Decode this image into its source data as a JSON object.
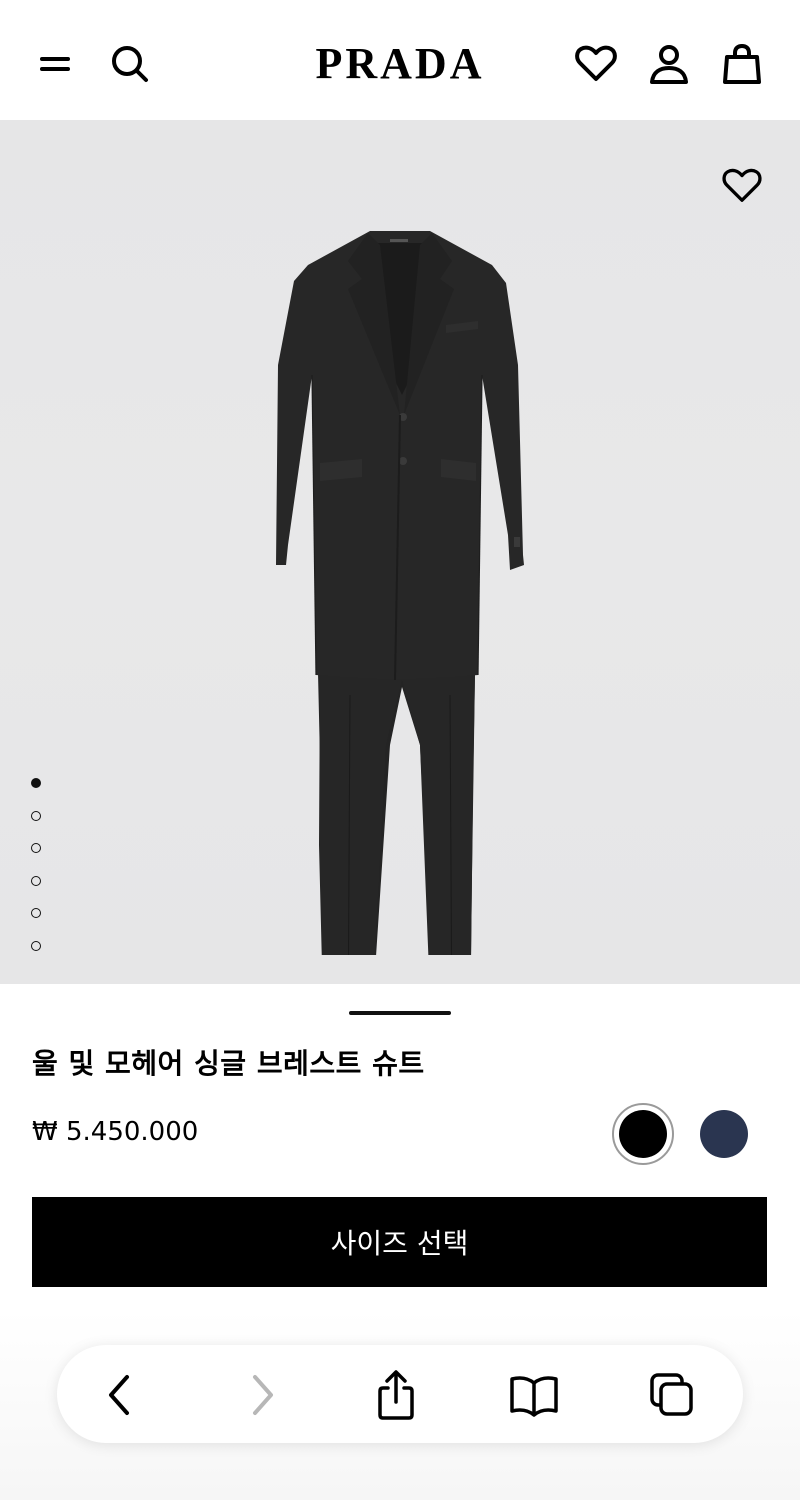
{
  "header": {
    "brand": "PRADA",
    "icons": [
      "menu-icon",
      "search-icon",
      "heart-icon",
      "user-icon",
      "shopping-bag-icon"
    ]
  },
  "gallery": {
    "image_description_icon": "suit-image",
    "image_count": 6,
    "active_index": 1,
    "favorite_icon": "heart-icon"
  },
  "product": {
    "title": "울 및 모헤어 싱글 브레스트 슈트",
    "price": "₩ 5.450.000",
    "colors": [
      {
        "name": "black",
        "hex": "#000000",
        "selected": true
      },
      {
        "name": "navy",
        "hex": "#2a3550",
        "selected": false
      }
    ],
    "cta_label": "사이즈 선택"
  },
  "browser_toolbar": {
    "icons": [
      "back-icon",
      "forward-icon",
      "share-icon",
      "bookmarks-icon",
      "tabs-icon"
    ]
  }
}
